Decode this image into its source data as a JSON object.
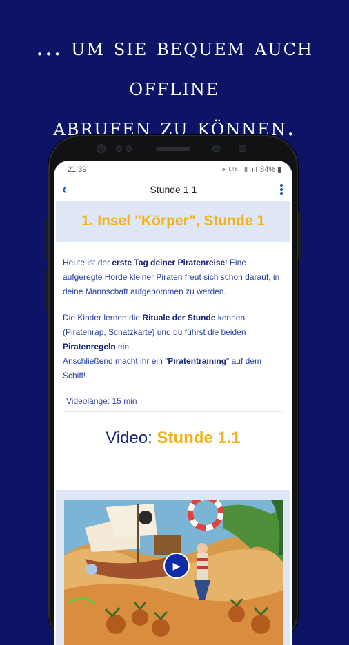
{
  "promo": {
    "line1": "... um sie bequem auch offline",
    "line2": "abrufen zu können."
  },
  "statusbar": {
    "time": "21:39",
    "icons": "⚬ ᴸᵀᴱ .ıll .ıll",
    "battery": "84%"
  },
  "appbar": {
    "back_icon": "‹",
    "title": "Stunde 1.1",
    "menu_icon": "more-vertical-icon"
  },
  "banner": {
    "title": "1. Insel \"Körper\", Stunde 1"
  },
  "content": {
    "p1": {
      "a": "Heute ist der ",
      "b": "erste Tag deiner Piratenreise",
      "c": "! Eine aufgeregte Horde kleiner Piraten freut sich schon darauf, in deine Mannschaft aufgenommen zu werden."
    },
    "p2": {
      "a": "Die Kinder lernen die ",
      "b": "Rituale der Stunde",
      "c": " kennen (Piratenrap, Schatzkarte) und du führst die beiden ",
      "d": "Piratenregeln",
      "e": " ein.",
      "f": "Anschließend macht ihr ein \"",
      "g": "Piratentraining",
      "h": "\" auf dem Schiff!"
    },
    "video_length": "Videolänge: 15 min"
  },
  "video": {
    "label": "Video: ",
    "value": "Stunde 1.1",
    "play_icon": "▶"
  },
  "colors": {
    "background": "#0d1466",
    "accent_yellow": "#f2b21a",
    "text_blue": "#2540a6",
    "banner_bg": "#dfe7f6"
  }
}
